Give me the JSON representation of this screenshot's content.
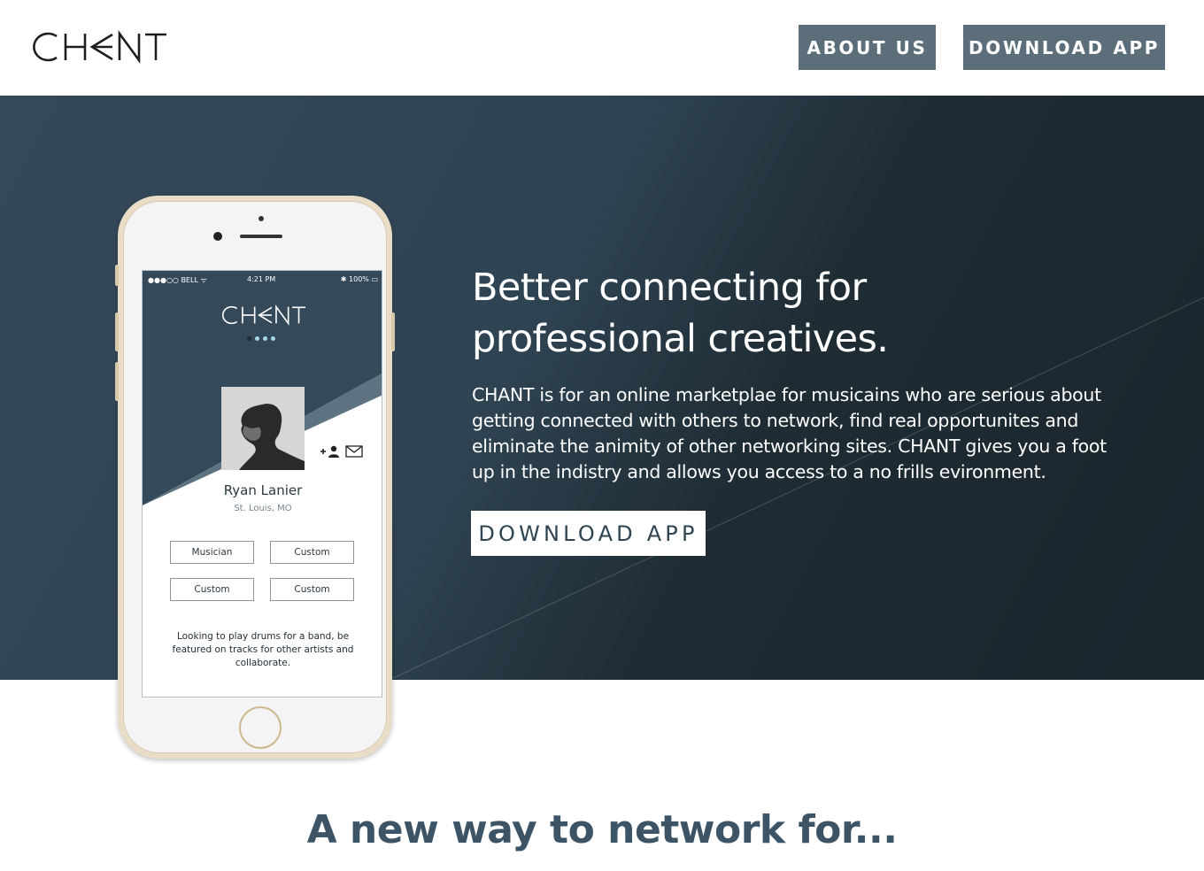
{
  "brand": {
    "logo_text": "CHANT"
  },
  "nav": {
    "about_label": "ABOUT US",
    "download_label": "DOWNLOAD APP"
  },
  "hero": {
    "headline_line1": "Better connecting for",
    "headline_line2": "professional creatives.",
    "description": "CHANT is for an online marketplae for musicains who are serious about getting connected with others to network, find real opportunites and eliminate the animity of other networking sites. CHANT gives you a foot up in the indistry and allows you access to a no frills evironment.",
    "cta_label": "DOWNLOAD APP"
  },
  "phone": {
    "status": {
      "carrier": "●●●○○ BELL ᯤ",
      "time": "4:21 PM",
      "battery": "✱  100% ▭"
    },
    "app_logo": "CHANT",
    "profile": {
      "name": "Ryan Lanier",
      "location": "St. Louis, MO",
      "tags": [
        "Musician",
        "Custom",
        "Custom",
        "Custom"
      ],
      "bio": "Looking to play drums for a band, be featured on tracks for other artists and collaborate."
    }
  },
  "section": {
    "title": "A new way to network for..."
  },
  "colors": {
    "nav_button_bg": "#5c6e79",
    "hero_dark": "#1b252c",
    "hero_mid": "#34495a",
    "title_text": "#3c5466",
    "phone_gold": "#e9ddc8"
  }
}
